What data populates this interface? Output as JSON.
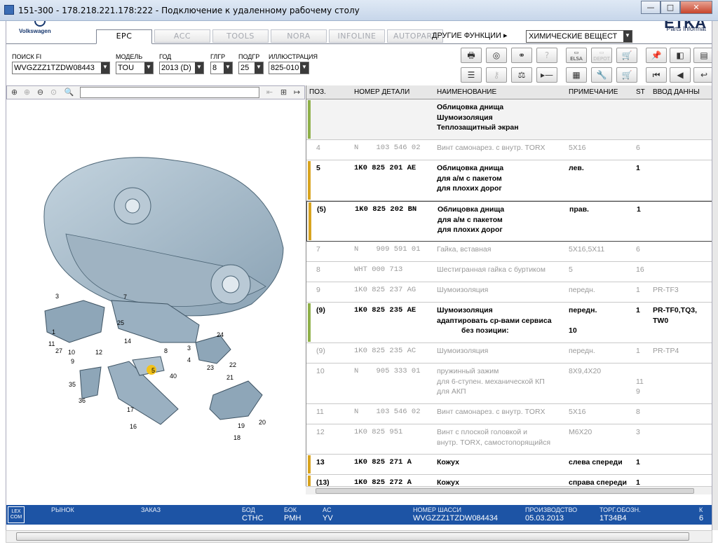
{
  "window": {
    "title": "151-300 - 178.218.221.178:222 - Подключение к удаленному рабочему столу",
    "minimize": "—",
    "maximize": "□",
    "close": "✕"
  },
  "brand": {
    "vw": "Volkswagen",
    "etka": "ETKA",
    "etka_sub": "Parts Informat"
  },
  "tabs": [
    "EPC",
    "ACC",
    "TOOLS",
    "NORA",
    "INFOLINE",
    "AUTOPART"
  ],
  "active_tab": "EPC",
  "other_functions": "ДРУГИЕ ФУНКЦИИ ▸",
  "chem_select": "ХИМИЧЕСКИЕ ВЕЩЕСТ",
  "filters": {
    "fi_label": "ПОИСК FI",
    "fi_value": "WVGZZZ1TZDW08443",
    "model_label": "МОДЕЛЬ",
    "model_value": "TOU",
    "year_label": "ГОД",
    "year_value": "2013 (D)",
    "hg_label": "ГЛГР",
    "hg_value": "8",
    "ug_label": "ПОДГР",
    "ug_value": "25",
    "ill_label": "ИЛЛЮСТРАЦИЯ",
    "ill_value": "825-010"
  },
  "tool_icons": [
    "print-icon",
    "disc-icon",
    "binoculars-icon",
    "question-icon",
    "elsa-icon",
    "depot-icon",
    "cart-add-icon",
    "pin-icon",
    "page-back-icon",
    "page-icon",
    "list-icon",
    "key-icon",
    "scale-icon",
    "play-minus-icon",
    "scroll-icon",
    "wrench-icon",
    "cart-icon",
    "first-icon",
    "prev-icon",
    "back-icon"
  ],
  "tool_labels": {
    "elsa": "ELSA",
    "depot": "DEPOT"
  },
  "table": {
    "headers": [
      "ПОЗ.",
      "НОМЕР ДЕТАЛИ",
      "НАИМЕНОВАНИЕ",
      "ПРИМЕЧАНИЕ",
      "ST",
      "ВВОД ДАННЫ"
    ],
    "rows": [
      {
        "pos": "",
        "part": "",
        "name": "Облицовка днища\nШумоизоляция\nТеплозащитный экран",
        "note": "",
        "st": "",
        "input": "",
        "style": "bold",
        "bar": "#8fb04a"
      },
      {
        "pos": "4",
        "part": "N    103 546 02",
        "name": "Винт самонарез. с внутр. TORX",
        "note": "5X16",
        "st": "6",
        "input": "",
        "style": "grey",
        "bar": ""
      },
      {
        "pos": "5",
        "part": "1K0 825 201 AE",
        "name": "Облицовка днища\nдля а/м с пакетом\nдля плохих дорог",
        "note": "лев.",
        "st": "1",
        "input": "",
        "style": "bold",
        "bar": "#d8a420"
      },
      {
        "pos": "(5)",
        "part": "1K0 825 202 BN",
        "name": "Облицовка днища\nдля а/м с пакетом\nдля плохих дорог",
        "note": "прав.",
        "st": "1",
        "input": "",
        "style": "bold sel",
        "bar": "#d8a420"
      },
      {
        "pos": "7",
        "part": "N    909 591 01",
        "name": "Гайка, вставная",
        "note": "5X16,5X11",
        "st": "6",
        "input": "",
        "style": "grey",
        "bar": ""
      },
      {
        "pos": "8",
        "part": "WHT 000 713",
        "name": "Шестигранная гайка с буртиком",
        "note": "5",
        "st": "16",
        "input": "",
        "style": "grey",
        "bar": ""
      },
      {
        "pos": "9",
        "part": "1K0 825 237 AG",
        "name": "Шумоизоляция",
        "note": "передн.",
        "st": "1",
        "input": "PR-TF3",
        "style": "grey",
        "bar": ""
      },
      {
        "pos": "(9)",
        "part": "1K0 825 235 AE",
        "name": "Шумоизоляция\nадаптировать ср-вами сервиса\n            без позиции:",
        "note": "передн.\n\n10",
        "st": "1",
        "input": "PR-TF0,TQ3,\nTW0",
        "style": "bold",
        "bar": "#8fb04a"
      },
      {
        "pos": "(9)",
        "part": "1K0 825 235 AC",
        "name": "Шумоизоляция",
        "note": "передн.",
        "st": "1",
        "input": "PR-TP4",
        "style": "grey",
        "bar": ""
      },
      {
        "pos": "10",
        "part": "N    905 333 01",
        "name": "пружинный зажим\nдля 6-ступен. механической КП\nдля АКП",
        "note": "8X9,4X20",
        "st": "\n11\n9",
        "input": "",
        "style": "grey",
        "bar": ""
      },
      {
        "pos": "11",
        "part": "N    103 546 02",
        "name": "Винт самонарез. с внутр. TORX",
        "note": "5X16",
        "st": "8",
        "input": "",
        "style": "grey",
        "bar": ""
      },
      {
        "pos": "12",
        "part": "1K0 825 951",
        "name": "Винт с плоской головкой и\nвнутр. TORX, самостопорящийся",
        "note": "M6X20",
        "st": "3",
        "input": "",
        "style": "grey",
        "bar": ""
      },
      {
        "pos": "13",
        "part": "1K0 825 271 A",
        "name": "Кожух",
        "note": "слева спереди",
        "st": "1",
        "input": "",
        "style": "bold",
        "bar": "#d8a420"
      },
      {
        "pos": "(13)",
        "part": "1K0 825 272 A",
        "name": "Кожух",
        "note": "справа спереди",
        "st": "1",
        "input": "",
        "style": "bold",
        "bar": "#d8a420"
      }
    ]
  },
  "status": {
    "lex": "LEX\nCOM",
    "market_label": "РЫНОК",
    "order_label": "ЗАКАЗ",
    "bod_label": "БОД",
    "bod_value": "CTHC",
    "bok_label": "БОК",
    "bok_value": "PMH",
    "ac_label": "AC",
    "ac_value": "YV",
    "chassis_label": "НОМЕР ШАССИ",
    "chassis_value": "WVGZZZ1TZDW084434",
    "prod_label": "ПРОИЗВОДСТВО",
    "prod_value": "05.03.2013",
    "trade_label": "ТОРГ.ОБОЗН.",
    "trade_value": "1T34B4",
    "k_label": "К",
    "k_value": "6"
  },
  "callouts": [
    "3",
    "7",
    "25",
    "14",
    "5",
    "8",
    "3",
    "4",
    "24",
    "1",
    "27",
    "11",
    "10",
    "12",
    "9",
    "22",
    "23",
    "21",
    "35",
    "36",
    "40",
    "17",
    "16",
    "19",
    "20",
    "18"
  ]
}
